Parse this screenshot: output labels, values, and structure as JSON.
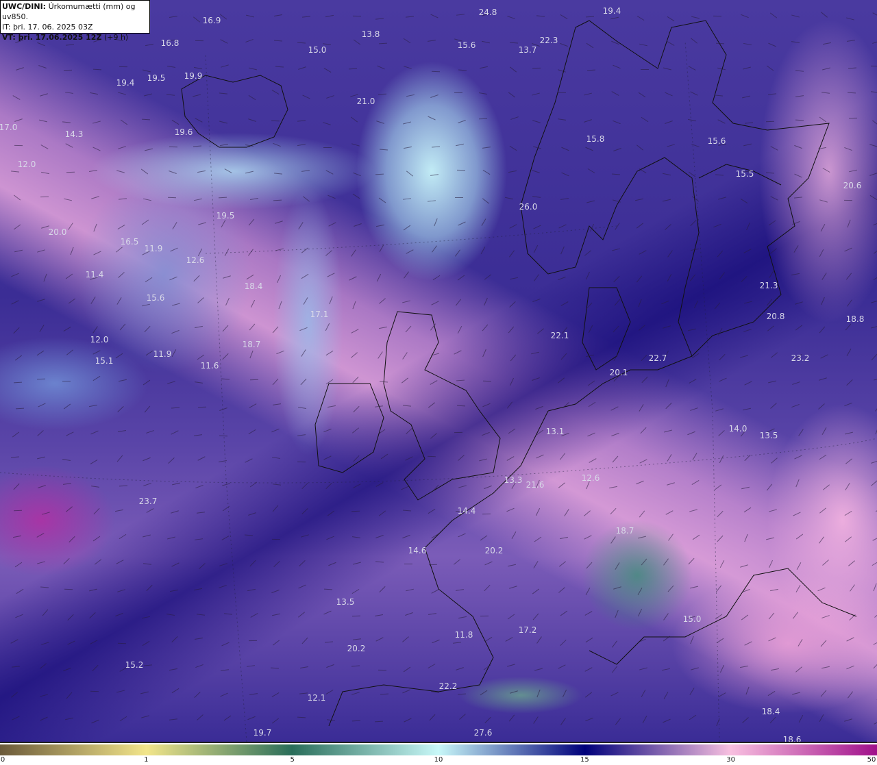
{
  "header": {
    "model": "UWC/DINI:",
    "parameter": "Úrkomumætti (mm) og uv850.",
    "initial_time": "IT: þri. 17. 06. 2025 03Z",
    "valid_time_bold": "VT: þri. 17.06.2025 12Z",
    "lead_time": "(+9 h)"
  },
  "colorbar": {
    "ticks": [
      "0",
      "1",
      "5",
      "10",
      "15",
      "30",
      "50"
    ],
    "colors": [
      "#6b5a3a",
      "#f2e58a",
      "#2a6e5a",
      "#c8f8f8",
      "#00007a",
      "#f8c0e0",
      "#a0108a"
    ]
  },
  "labels": [
    "24.8",
    "19.4",
    "16.9",
    "13.8",
    "15.0",
    "15.6",
    "13.7",
    "22.3",
    "16.8",
    "19.9",
    "19.4",
    "19.5",
    "21.0",
    "17.0",
    "14.3",
    "19.6",
    "15.8",
    "15.6",
    "12.0",
    "15.5",
    "20.6",
    "26.0",
    "19.5",
    "20.0",
    "16.5",
    "11.9",
    "12.6",
    "11.4",
    "18.4",
    "15.6",
    "21.3",
    "17.1",
    "20.8",
    "18.8",
    "22.1",
    "12.0",
    "18.7",
    "11.9",
    "15.1",
    "11.6",
    "23.2",
    "20.1",
    "22.7",
    "13.1",
    "14.0",
    "13.5",
    "12.6",
    "13.3",
    "21.6",
    "14.4",
    "14.6",
    "20.2",
    "18.7",
    "13.5",
    "17.2",
    "11.8",
    "20.2",
    "15.2",
    "22.2",
    "12.1",
    "18.4",
    "19.7",
    "27.6",
    "18.6",
    "23.7",
    "15.0"
  ]
}
